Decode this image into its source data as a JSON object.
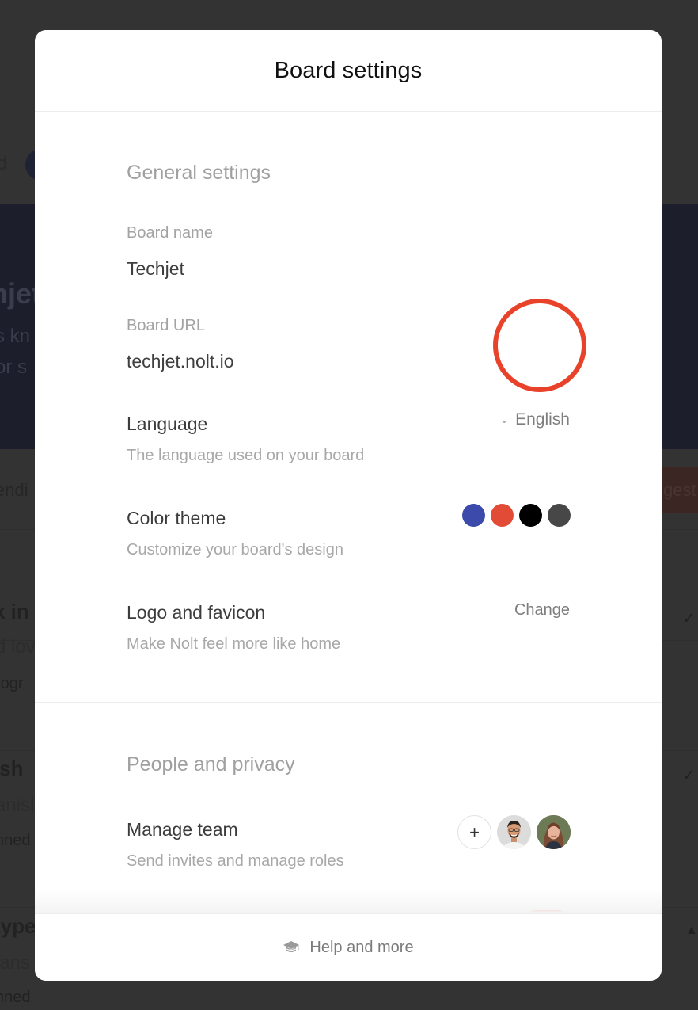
{
  "background": {
    "nav_fragment": "d",
    "board_title_fragment": "njet",
    "board_desc_line1": "s kn",
    "board_desc_line2": " or s",
    "sort_fragment": "endi",
    "suggest_fragment": "gest",
    "posts": [
      {
        "title": "k in",
        "desc": "d lov",
        "status": "rogr"
      },
      {
        "title": "ish",
        "desc": "anish",
        "status": "nned"
      },
      {
        "title": "type",
        "desc": "lans",
        "status": "nned"
      }
    ]
  },
  "modal": {
    "title": "Board settings",
    "general": {
      "section_title": "General settings",
      "board_name": {
        "label": "Board name",
        "value": "Techjet"
      },
      "board_url": {
        "label": "Board URL",
        "value": "techjet.nolt.io"
      },
      "language": {
        "title": "Language",
        "description": "The language used on your board",
        "selected": "English",
        "chevron_icon": "chevron-down-icon"
      },
      "color_theme": {
        "title": "Color theme",
        "description": "Customize your board's design",
        "colors": [
          "#3b4aab",
          "#e24b36",
          "#000000",
          "#474747"
        ]
      },
      "logo": {
        "title": "Logo and favicon",
        "description": "Make Nolt feel more like home",
        "action": "Change"
      }
    },
    "people": {
      "section_title": "People and privacy",
      "manage_team": {
        "title": "Manage team",
        "description": "Send invites and manage roles",
        "add_symbol": "+"
      }
    },
    "footer": {
      "label": "Help and more",
      "icon": "graduation-cap-icon"
    }
  },
  "annotation": {
    "color": "#e8432a",
    "target": "language-select"
  }
}
